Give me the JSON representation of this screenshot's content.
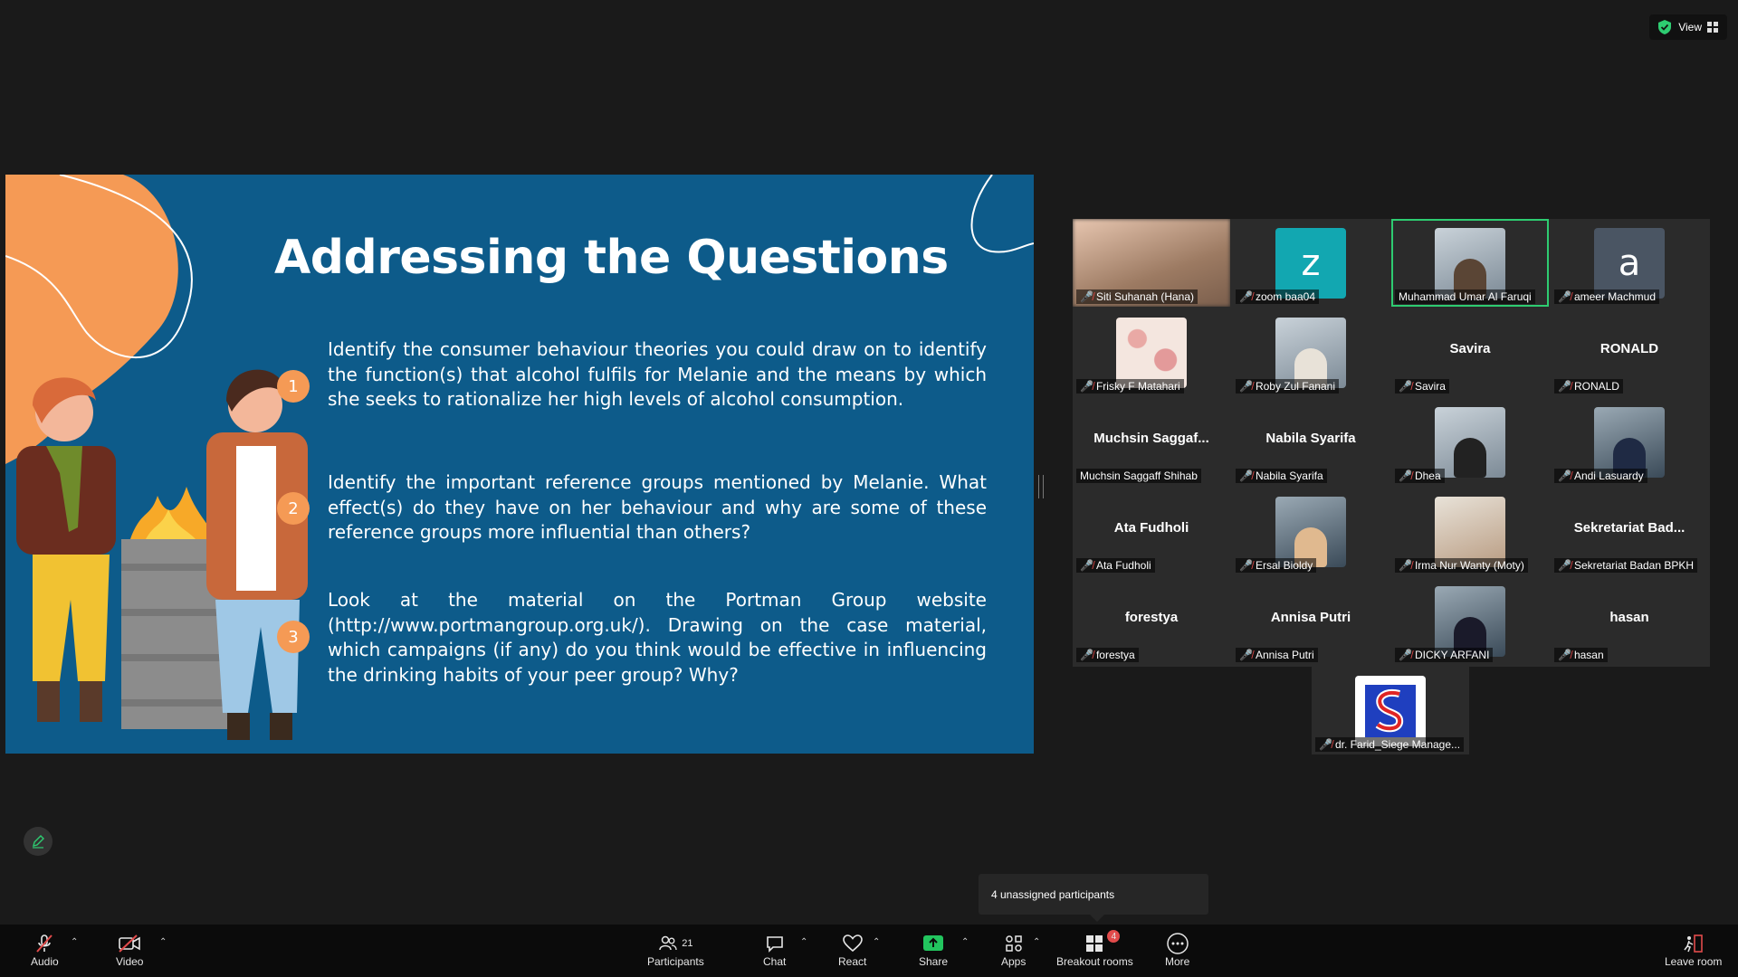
{
  "top": {
    "view_label": "View"
  },
  "slide": {
    "title": "Addressing the Questions",
    "questions": [
      {
        "num": "1",
        "text": "Identify the consumer behaviour theories you could draw on to identify the function(s) that alcohol fulfils for Melanie and the means by which she seeks to rationalize her high levels of alcohol consumption."
      },
      {
        "num": "2",
        "text": "Identify the important reference groups mentioned by Melanie. What effect(s) do they have on her behaviour and why are some of these reference groups more influential than others?"
      },
      {
        "num": "3",
        "text": "Look at the material on the Portman Group website (http://www.portmangroup.org.uk/). Drawing on the case material, which campaigns (if any) do you think would be effective in influencing the drinking habits of your peer group? Why?"
      }
    ],
    "colors": {
      "background": "#0d5b8a",
      "accent": "#f59a55"
    }
  },
  "gallery": {
    "tiles": [
      {
        "label": "Siti Suhanah (Hana)"
      },
      {
        "label": "zoom baa04",
        "avatar_letter": "z"
      },
      {
        "label": "Muhammad Umar Al Faruqi"
      },
      {
        "label": "ameer Machmud",
        "avatar_letter": "a"
      },
      {
        "label": "Frisky F Matahari"
      },
      {
        "label": "Roby Zul Fanani"
      },
      {
        "label": "Savira",
        "center": "Savira"
      },
      {
        "label": "RONALD",
        "center": "RONALD"
      },
      {
        "label": "Muchsin Saggaff Shihab",
        "center": "Muchsin  Saggaf..."
      },
      {
        "label": "Nabila Syarifa",
        "center": "Nabila Syarifa"
      },
      {
        "label": "Dhea"
      },
      {
        "label": "Andi Lasuardy"
      },
      {
        "label": "Ata Fudholi",
        "center": "Ata Fudholi"
      },
      {
        "label": "Ersal Bioldy"
      },
      {
        "label": "Irma Nur Wanty (Moty)"
      },
      {
        "label": "Sekretariat Badan BPKH",
        "center": "Sekretariat  Bad..."
      },
      {
        "label": "forestya",
        "center": "forestya"
      },
      {
        "label": "Annisa Putri",
        "center": "Annisa Putri"
      },
      {
        "label": "DICKY ARFANI"
      },
      {
        "label": "hasan",
        "center": "hasan"
      },
      {
        "label": "dr. Farid_Siege Manage..."
      }
    ]
  },
  "tooltip": {
    "text": "4 unassigned participants"
  },
  "toolbar": {
    "audio": "Audio",
    "video": "Video",
    "participants": "Participants",
    "participants_count": "21",
    "chat": "Chat",
    "react": "React",
    "share": "Share",
    "apps": "Apps",
    "breakout": "Breakout rooms",
    "breakout_badge": "4",
    "more": "More",
    "leave": "Leave room"
  }
}
